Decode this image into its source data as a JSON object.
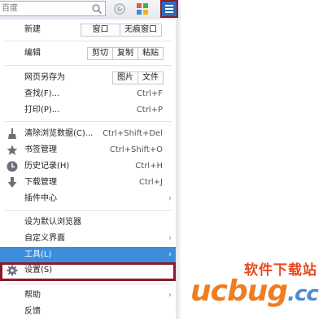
{
  "search": {
    "placeholder": "百度"
  },
  "menu": {
    "new": {
      "label": "新建",
      "buttons": [
        "窗口",
        "无痕窗口"
      ]
    },
    "edit": {
      "label": "编辑",
      "buttons": [
        "剪切",
        "复制",
        "粘贴"
      ]
    },
    "save_page": {
      "label": "网页另存为",
      "buttons": [
        "图片",
        "文件"
      ]
    },
    "find": {
      "label": "查找(F)...",
      "shortcut": "Ctrl+F"
    },
    "print": {
      "label": "打印(P)...",
      "shortcut": "Ctrl+P"
    },
    "clear_data": {
      "label": "清除浏览数据(C)...",
      "shortcut": "Ctrl+Shift+Del"
    },
    "bookmarks": {
      "label": "书签管理",
      "shortcut": "Ctrl+Shift+O"
    },
    "history": {
      "label": "历史记录(H)",
      "shortcut": "Ctrl+H"
    },
    "downloads": {
      "label": "下载管理",
      "shortcut": "Ctrl+J"
    },
    "plugins": {
      "label": "插件中心"
    },
    "set_default": {
      "label": "设为默认浏览器"
    },
    "customize": {
      "label": "自定义界面"
    },
    "tools": {
      "label": "工具(L)"
    },
    "settings": {
      "label": "设置(S)"
    },
    "help": {
      "label": "帮助"
    },
    "feedback": {
      "label": "反馈"
    }
  },
  "watermark": {
    "cn": "软件下载站",
    "en_main": "ucbug",
    "en_tld": ".cc"
  },
  "colors": {
    "highlight": "#3d8ddd",
    "focus_border": "#8a1b2a",
    "menu_button": "#2e6db5",
    "watermark_orange": "#f07d22",
    "watermark_blue": "#4e8bd0"
  }
}
